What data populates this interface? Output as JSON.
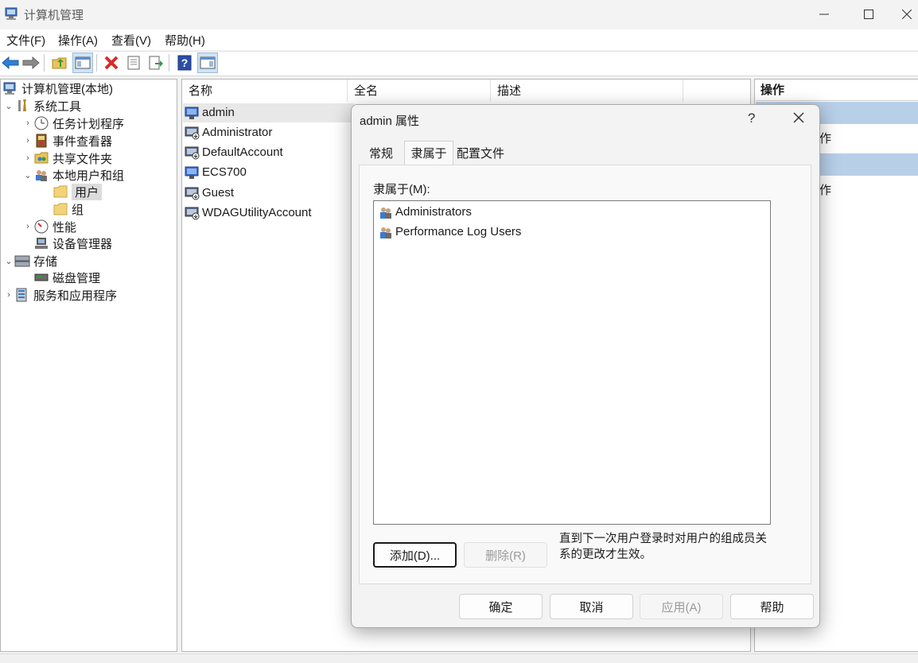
{
  "window": {
    "title": "计算机管理",
    "controls": [
      "minimize-icon",
      "maximize-icon",
      "close-icon"
    ]
  },
  "menubar": {
    "items": [
      {
        "label": "文件(F)"
      },
      {
        "label": "操作(A)"
      },
      {
        "label": "查看(V)"
      },
      {
        "label": "帮助(H)"
      }
    ]
  },
  "toolbar": {
    "buttons": [
      "back-arrow-icon",
      "forward-arrow-icon",
      "up-folder-icon",
      "show-hide-console-tree-icon",
      "delete-icon",
      "properties-icon",
      "export-list-icon",
      "help-icon",
      "show-hide-action-pane-icon"
    ]
  },
  "tree": {
    "root": "计算机管理(本地)",
    "items": [
      {
        "label": "系统工具",
        "expanded": true
      },
      {
        "label": "任务计划程序"
      },
      {
        "label": "事件查看器"
      },
      {
        "label": "共享文件夹"
      },
      {
        "label": "本地用户和组",
        "expanded": true
      },
      {
        "label": "用户",
        "selected": true
      },
      {
        "label": "组"
      },
      {
        "label": "性能"
      },
      {
        "label": "设备管理器"
      },
      {
        "label": "存储",
        "expanded": true
      },
      {
        "label": "磁盘管理"
      },
      {
        "label": "服务和应用程序"
      }
    ]
  },
  "list": {
    "columns": [
      "名称",
      "全名",
      "描述"
    ],
    "rows": [
      {
        "name": "admin",
        "selected": true
      },
      {
        "name": "Administrator"
      },
      {
        "name": "DefaultAccount"
      },
      {
        "name": "ECS700"
      },
      {
        "name": "Guest"
      },
      {
        "name": "WDAGUtilityAccount"
      }
    ]
  },
  "actions": {
    "header": "操作",
    "item_fragment_1": "作",
    "item_fragment_2": "作"
  },
  "dialog": {
    "title": "admin 属性",
    "help_glyph": "?",
    "tabs": [
      {
        "label": "常规"
      },
      {
        "label": "隶属于",
        "active": true
      },
      {
        "label": "配置文件"
      }
    ],
    "member_of_label": "隶属于(M):",
    "member_of": [
      "Administrators",
      "Performance Log Users"
    ],
    "add_button": "添加(D)...",
    "remove_button": "删除(R)",
    "note": "直到下一次用户登录时对用户的组成员关系的更改才生效。",
    "ok_button": "确定",
    "cancel_button": "取消",
    "apply_button": "应用(A)",
    "help_button": "帮助"
  },
  "colors": {
    "action_highlight": "#b8cfe8",
    "delete_red": "#d92b2b",
    "help_blue": "#2b4fa8"
  }
}
